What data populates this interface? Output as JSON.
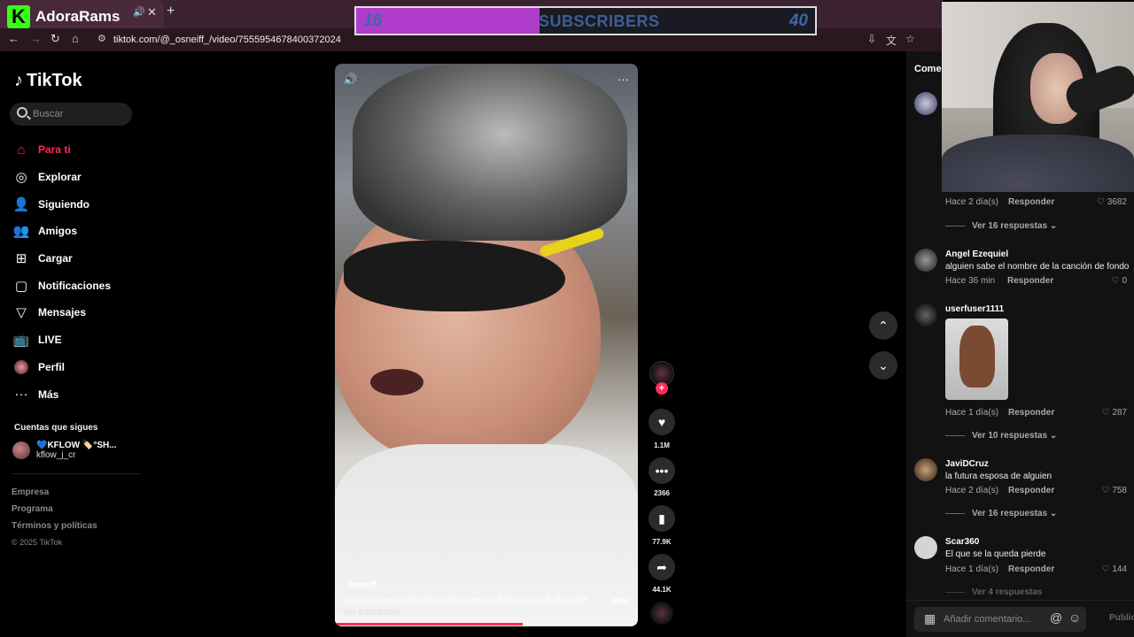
{
  "browser": {
    "tab_title": "AdoraRams",
    "tab_logo": "K",
    "url": "tiktok.com/@_osneiff_/video/7555954678400372024"
  },
  "sub_counter": {
    "current": "16",
    "label": "SUBSCRIBERS",
    "goal": "40",
    "progress_fraction": 0.4,
    "fill_color": "#b03ccc"
  },
  "sidebar": {
    "brand": "TikTok",
    "search_placeholder": "Buscar",
    "nav": [
      {
        "label": "Para ti",
        "icon": "home-icon"
      },
      {
        "label": "Explorar",
        "icon": "compass-icon"
      },
      {
        "label": "Siguiendo",
        "icon": "user-follow-icon"
      },
      {
        "label": "Amigos",
        "icon": "friends-icon"
      },
      {
        "label": "Cargar",
        "icon": "upload-icon"
      },
      {
        "label": "Notificaciones",
        "icon": "inbox-icon"
      },
      {
        "label": "Mensajes",
        "icon": "send-icon"
      },
      {
        "label": "LIVE",
        "icon": "live-icon"
      },
      {
        "label": "Perfil",
        "icon": "profile-avatar-icon"
      },
      {
        "label": "Más",
        "icon": "more-dots-icon"
      }
    ],
    "following_title": "Cuentas que sigues",
    "following": [
      {
        "name": "💙KFLOW 🏷️°SH...",
        "handle": "kflow_j_cr"
      }
    ],
    "footer_links": [
      "Empresa",
      "Programa",
      "Términos y políticas"
    ],
    "copyright": "© 2025 TikTok"
  },
  "video": {
    "author": "_osneiff_",
    "caption": "nossa lari aproveitando muitooo #osneiff  #larissaneiff  #larineiff  ...",
    "more_label": "más",
    "translate_label": "Ver traducción",
    "progress_fraction": 0.62,
    "accent_color": "#fe2c55"
  },
  "actions": {
    "likes": "1.1M",
    "comments": "2366",
    "saves": "77.9K",
    "shares": "44.1K"
  },
  "comments_panel": {
    "title": "Comer",
    "reply_label": "Responder",
    "input_placeholder": "Añadir comentario...",
    "publish_label": "Publicar",
    "items": [
      {
        "meta": "Hace 2 día(s)",
        "likes": "3682",
        "replies": "Ver 16 respuestas"
      },
      {
        "user": "Angel Ezequiel",
        "text": "alguien sabe el nombre de la canción de fondo",
        "meta": "Hace 36 min",
        "likes": "0"
      },
      {
        "user": "userfuser1111",
        "meta": "Hace 1 día(s)",
        "likes": "287",
        "replies": "Ver 10 respuestas"
      },
      {
        "user": "JaviDCruz",
        "text": "la futura esposa de alguien",
        "meta": "Hace 2 día(s)",
        "likes": "758",
        "replies": "Ver 16 respuestas"
      },
      {
        "user": "Scar360",
        "text": "El que se la queda pierde",
        "meta": "Hace 1 día(s)",
        "likes": "144",
        "replies": "Ver 4 respuestas"
      }
    ]
  }
}
